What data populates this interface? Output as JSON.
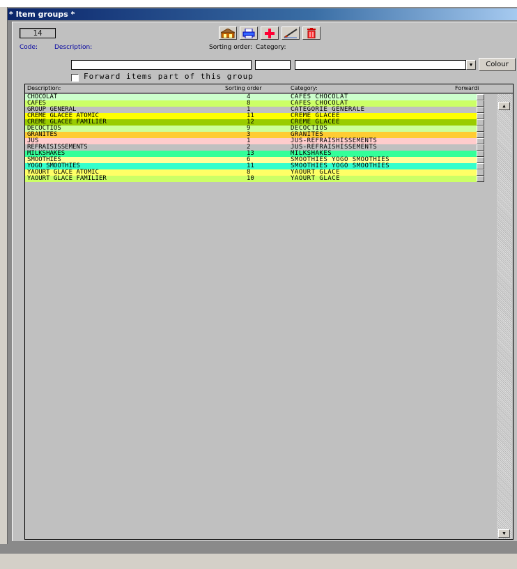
{
  "window": {
    "title": "* Item groups *"
  },
  "form": {
    "code_value": "14",
    "code_label": "Code:",
    "description_label": "Description:",
    "description_value": "",
    "sorting_label": "Sorting order:",
    "sorting_value": "",
    "category_label": "Category:",
    "category_value": "",
    "colour_button": "Colour",
    "forward_label": "Forward items part of this group"
  },
  "toolbar": {
    "buttons": [
      {
        "icon": "house-icon"
      },
      {
        "icon": "print-icon"
      },
      {
        "icon": "add-icon"
      },
      {
        "icon": "edit-icon"
      },
      {
        "icon": "delete-icon"
      }
    ]
  },
  "table": {
    "headers": {
      "description": "Description:",
      "sorting": "Sorting order",
      "category": "Category:",
      "forward": "Forwardi"
    },
    "rows": [
      {
        "description": "CHOCOLAT",
        "sorting": "4",
        "category": "CAFES CHOCOLAT",
        "color": "#ccffcc"
      },
      {
        "description": "CAFES",
        "sorting": "8",
        "category": "CAFES CHOCOLAT",
        "color": "#ccff66"
      },
      {
        "description": "GROUP GENERAL",
        "sorting": "1",
        "category": "CATEGORIE GENERALE",
        "color": "#c0c0c0"
      },
      {
        "description": "CREME GLACEE ATOMIC",
        "sorting": "11",
        "category": "CREME GLACEE",
        "color": "#ffff00"
      },
      {
        "description": "CREME GLACEE FAMILIER",
        "sorting": "12",
        "category": "CREME GLACEE",
        "color": "#99cc00"
      },
      {
        "description": "DECOCTIOS",
        "sorting": "9",
        "category": "DECOCTIOS",
        "color": "#ccff99"
      },
      {
        "description": "GRANITES",
        "sorting": "3",
        "category": "GRANITES",
        "color": "#ffcc33"
      },
      {
        "description": "JUS",
        "sorting": "1",
        "category": "JUS-REFRAISHISSEMENTS",
        "color": "#ffcccc"
      },
      {
        "description": "REFRAISISSEMENTS",
        "sorting": "2",
        "category": "JUS-REFRAISHISSEMENTS",
        "color": "#c0c0c0"
      },
      {
        "description": "MILKSHAKES",
        "sorting": "13",
        "category": "MILKSHAKES",
        "color": "#33ff99"
      },
      {
        "description": "SMOOTHIES",
        "sorting": "6",
        "category": "SMOOTHIES YOGO SMOOTHIES",
        "color": "#ffff99"
      },
      {
        "description": "YOGO SMOOTHIES",
        "sorting": "11",
        "category": "SMOOTHIES YOGO SMOOTHIES",
        "color": "#33ffcc"
      },
      {
        "description": "YAOURT GLACE ATOMIC",
        "sorting": "8",
        "category": "YAOURT GLACE",
        "color": "#ffff66"
      },
      {
        "description": "YAOURT GLACE FAMILIER",
        "sorting": "10",
        "category": "YAOURT GLACE",
        "color": "#ccff66"
      }
    ]
  }
}
